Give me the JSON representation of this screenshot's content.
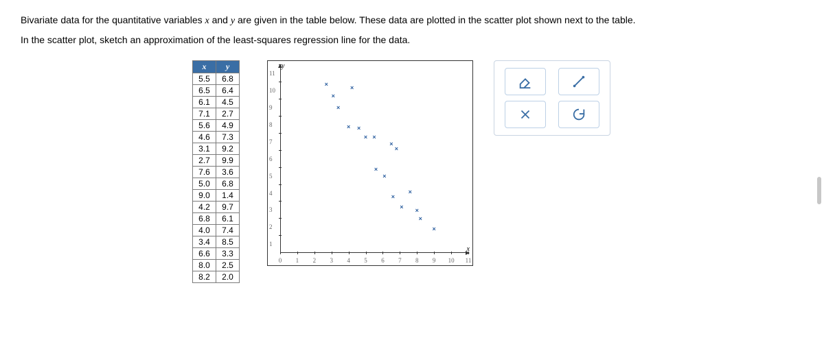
{
  "instructions": {
    "line1_pre": "Bivariate data for the quantitative variables ",
    "line1_mid": " and ",
    "line1_post": " are given in the table below. These data are plotted in the scatter plot shown next to the table.",
    "line2": "In the scatter plot, sketch an approximation of the least-squares regression line for the data.",
    "var_x": "x",
    "var_y": "y"
  },
  "table": {
    "header_x": "x",
    "header_y": "y",
    "rows": [
      {
        "x": "5.5",
        "y": "6.8"
      },
      {
        "x": "6.5",
        "y": "6.4"
      },
      {
        "x": "6.1",
        "y": "4.5"
      },
      {
        "x": "7.1",
        "y": "2.7"
      },
      {
        "x": "5.6",
        "y": "4.9"
      },
      {
        "x": "4.6",
        "y": "7.3"
      },
      {
        "x": "3.1",
        "y": "9.2"
      },
      {
        "x": "2.7",
        "y": "9.9"
      },
      {
        "x": "7.6",
        "y": "3.6"
      },
      {
        "x": "5.0",
        "y": "6.8"
      },
      {
        "x": "9.0",
        "y": "1.4"
      },
      {
        "x": "4.2",
        "y": "9.7"
      },
      {
        "x": "6.8",
        "y": "6.1"
      },
      {
        "x": "4.0",
        "y": "7.4"
      },
      {
        "x": "3.4",
        "y": "8.5"
      },
      {
        "x": "6.6",
        "y": "3.3"
      },
      {
        "x": "8.0",
        "y": "2.5"
      },
      {
        "x": "8.2",
        "y": "2.0"
      }
    ]
  },
  "chart_data": {
    "type": "scatter",
    "title": "",
    "xlabel": "x",
    "ylabel": "y",
    "xlim": [
      0,
      11
    ],
    "ylim": [
      0,
      11
    ],
    "x_ticks": [
      0,
      1,
      2,
      3,
      4,
      5,
      6,
      7,
      8,
      9,
      10,
      11
    ],
    "y_ticks": [
      1,
      2,
      3,
      4,
      5,
      6,
      7,
      8,
      9,
      10,
      11
    ],
    "series": [
      {
        "name": "data",
        "points": [
          [
            5.5,
            6.8
          ],
          [
            6.5,
            6.4
          ],
          [
            6.1,
            4.5
          ],
          [
            7.1,
            2.7
          ],
          [
            5.6,
            4.9
          ],
          [
            4.6,
            7.3
          ],
          [
            3.1,
            9.2
          ],
          [
            2.7,
            9.9
          ],
          [
            7.6,
            3.6
          ],
          [
            5.0,
            6.8
          ],
          [
            9.0,
            1.4
          ],
          [
            4.2,
            9.7
          ],
          [
            6.8,
            6.1
          ],
          [
            4.0,
            7.4
          ],
          [
            3.4,
            8.5
          ],
          [
            6.6,
            3.3
          ],
          [
            8.0,
            2.5
          ],
          [
            8.2,
            2.0
          ]
        ]
      }
    ]
  },
  "tools": {
    "eraser_name": "eraser-icon",
    "line_name": "line-tool-icon",
    "clear_name": "clear-icon",
    "reset_name": "reset-icon"
  }
}
